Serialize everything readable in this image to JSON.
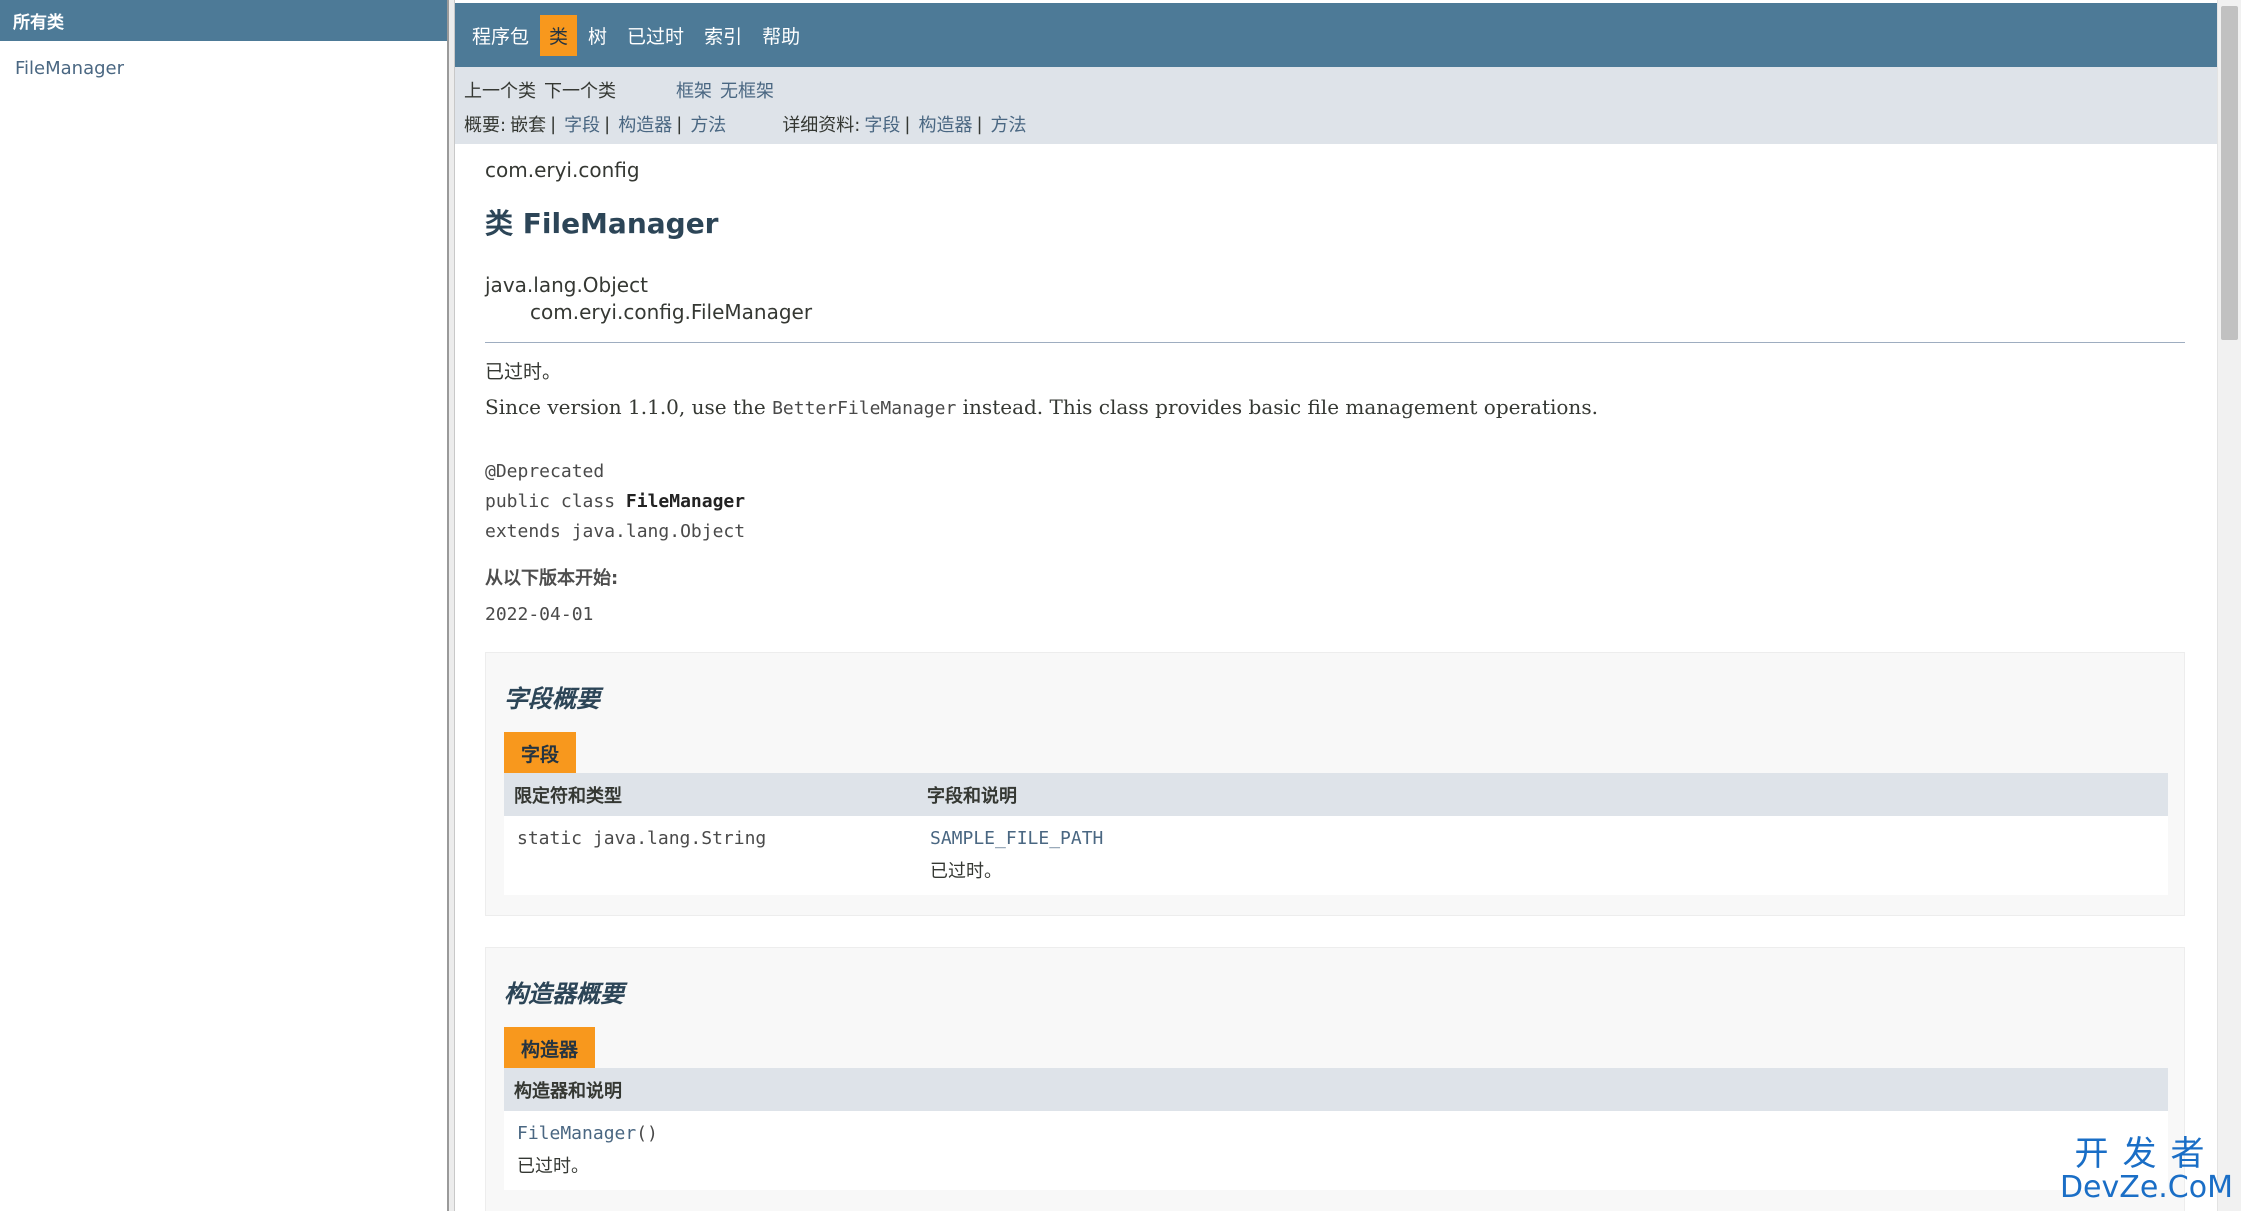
{
  "left_frame": {
    "header": "所有类",
    "classes": [
      "FileManager"
    ]
  },
  "top_nav": {
    "items": [
      {
        "label": "程序包",
        "active": false
      },
      {
        "label": "类",
        "active": true
      },
      {
        "label": "树",
        "active": false
      },
      {
        "label": "已过时",
        "active": false
      },
      {
        "label": "索引",
        "active": false
      },
      {
        "label": "帮助",
        "active": false
      }
    ]
  },
  "sub_nav": {
    "prev_class": "上一个类",
    "next_class": "下一个类",
    "frames": "框架",
    "no_frames": "无框架",
    "summary_label": "概要:",
    "summary_nested": "嵌套",
    "summary_field": "字段",
    "summary_constructor": "构造器",
    "summary_method": "方法",
    "detail_label": "详细资料:",
    "detail_field": "字段",
    "detail_constructor": "构造器",
    "detail_method": "方法",
    "separator": "|"
  },
  "class_info": {
    "package": "com.eryi.config",
    "title": "类 FileManager",
    "inheritance_root": "java.lang.Object",
    "inheritance_child": "com.eryi.config.FileManager",
    "deprecated_label": "已过时。",
    "description_prefix": "Since version 1.1.0, use the ",
    "description_code": "BetterFileManager",
    "description_suffix": " instead. This class provides basic file management operations.",
    "annotation": "@Deprecated",
    "signature_prefix": "public class ",
    "signature_name": "FileManager",
    "extends_line": "extends java.lang.Object",
    "since_label": "从以下版本开始:",
    "since_value": "2022-04-01"
  },
  "field_summary": {
    "heading": "字段概要",
    "caption": "字段",
    "col_modifier": "限定符和类型",
    "col_field": "字段和说明",
    "rows": [
      {
        "modifier": "static java.lang.String",
        "name": "SAMPLE_FILE_PATH",
        "note": "已过时。"
      }
    ]
  },
  "constructor_summary": {
    "heading": "构造器概要",
    "caption": "构造器",
    "col_constructor": "构造器和说明",
    "rows": [
      {
        "name": "FileManager",
        "params": "()",
        "note": "已过时。"
      }
    ]
  },
  "watermark": {
    "top": "开发者",
    "bottom": "DevZe.CoM"
  }
}
